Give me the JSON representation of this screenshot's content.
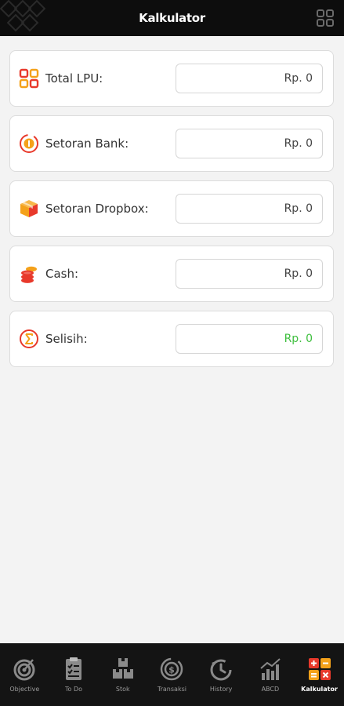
{
  "header": {
    "title": "Kalkulator",
    "menu_icon": "grid-icon"
  },
  "fields": [
    {
      "key": "total_lpu",
      "label": "Total LPU:",
      "value": "Rp. 0",
      "icon": "grid-squares-icon"
    },
    {
      "key": "setoran_bank",
      "label": "Setoran Bank:",
      "value": "Rp. 0",
      "icon": "coin-deposit-icon"
    },
    {
      "key": "setoran_dropbox",
      "label": "Setoran Dropbox:",
      "value": "Rp. 0",
      "icon": "box-icon"
    },
    {
      "key": "cash",
      "label": "Cash:",
      "value": "Rp. 0",
      "icon": "coin-stack-icon"
    },
    {
      "key": "selisih",
      "label": "Selisih:",
      "value": "Rp. 0",
      "icon": "sigma-icon"
    }
  ],
  "colors": {
    "header_bg": "#0d0d0d",
    "accent_red": "#e8392b",
    "accent_orange": "#f4a11a",
    "selisih_value": "#3fbf3f",
    "nav_bg": "#141414"
  },
  "bottom_nav": [
    {
      "label": "Objective",
      "icon": "target-icon",
      "active": false
    },
    {
      "label": "To Do",
      "icon": "checklist-icon",
      "active": false
    },
    {
      "label": "Stok",
      "icon": "boxes-icon",
      "active": false
    },
    {
      "label": "Transaksi",
      "icon": "money-icon",
      "active": false
    },
    {
      "label": "History",
      "icon": "clock-icon",
      "active": false
    },
    {
      "label": "ABCD",
      "icon": "bar-chart-icon",
      "active": false
    },
    {
      "label": "Kalkulator",
      "icon": "calculator-icon",
      "active": true
    }
  ]
}
